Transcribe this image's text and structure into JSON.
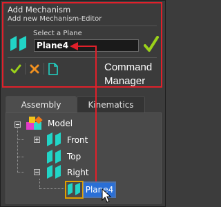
{
  "panel": {
    "title": "Add Mechanism",
    "subtitle": "Add new Mechanism-Editor",
    "select_label": "Select a Plane",
    "plane_value": "Plane4",
    "caption_line1": "Command",
    "caption_line2": "Manager"
  },
  "tabs": [
    {
      "label": "Assembly",
      "active": true
    },
    {
      "label": "Kinematics",
      "active": false
    }
  ],
  "tree": {
    "root": "Model",
    "children": [
      "Front",
      "Top",
      "Right"
    ],
    "selected": "Plane4"
  },
  "colors": {
    "highlight_red": "#e0202a",
    "plane_icon": "#21d4c6",
    "confirm_green": "#9bd21a",
    "cancel_orange": "#f09020",
    "selection_blue": "#2a6fd6"
  },
  "icons": {
    "plane": "plane-icon",
    "confirm": "checkmark-icon",
    "cancel": "close-icon",
    "document": "document-icon",
    "model": "model-icon",
    "cursor": "mouse-cursor-icon"
  }
}
